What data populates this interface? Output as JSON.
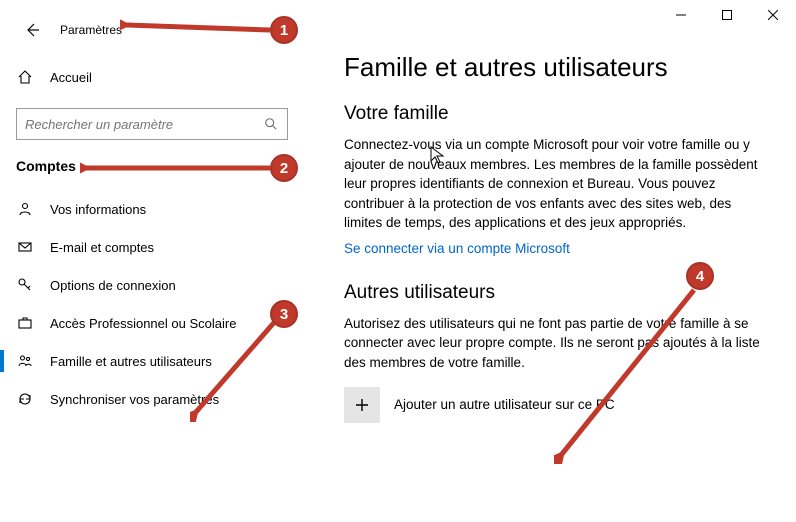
{
  "titlebar": {
    "title": "Paramètres"
  },
  "search": {
    "placeholder": "Rechercher un paramètre"
  },
  "category": "Comptes",
  "sidebar": {
    "home": "Accueil",
    "items": [
      {
        "label": "Vos informations"
      },
      {
        "label": "E-mail et comptes"
      },
      {
        "label": "Options de connexion"
      },
      {
        "label": "Accès Professionnel ou Scolaire"
      },
      {
        "label": "Famille et autres utilisateurs"
      },
      {
        "label": "Synchroniser vos paramètres"
      }
    ]
  },
  "main": {
    "title": "Famille et autres utilisateurs",
    "family_heading": "Votre famille",
    "family_body": "Connectez-vous via un compte Microsoft pour voir votre famille ou y ajouter de nouveaux membres. Les membres de la famille possèdent leur propres identifiants de connexion et Bureau. Vous pouvez contribuer à la protection de vos enfants avec des sites web, des limites de temps, des applications et des jeux appropriés.",
    "signin_link": "Se connecter via un compte Microsoft",
    "others_heading": "Autres utilisateurs",
    "others_body": "Autorisez des utilisateurs qui ne font pas partie de votre famille à se connecter avec leur propre compte. Ils ne seront pas ajoutés à la liste des membres de votre famille.",
    "add_user": "Ajouter un autre utilisateur sur ce PC"
  },
  "annotations": {
    "c1": "1",
    "c2": "2",
    "c3": "3",
    "c4": "4"
  }
}
